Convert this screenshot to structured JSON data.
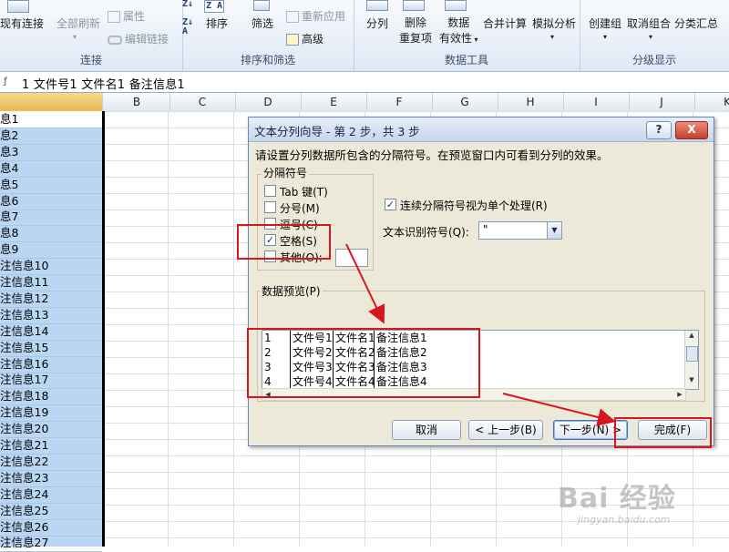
{
  "ribbon": {
    "existing_connections": "现有连接",
    "refresh_all": "全部刷新",
    "properties": "属性",
    "edit_links": "编辑链接",
    "connections_group": "连接",
    "sort_az": "A→Z",
    "sort": "排序",
    "filter": "筛选",
    "reapply": "重新应用",
    "advanced": "高级",
    "sort_filter_group": "排序和筛选",
    "text_to_columns": "分列",
    "remove_duplicates_1": "删除",
    "remove_duplicates_2": "重复项",
    "data_validation_1": "数据",
    "data_validation_2": "有效性",
    "consolidate": "合并计算",
    "what_if": "模拟分析",
    "data_tools_group": "数据工具",
    "group": "创建组",
    "ungroup": "取消组合",
    "subtotal": "分类汇总",
    "outline_group": "分级显示"
  },
  "formula_bar": {
    "content": "1  文件号1  文件名1  备注信息1"
  },
  "columns": [
    "B",
    "C",
    "D",
    "E",
    "F",
    "G",
    "H",
    "I",
    "J",
    "K"
  ],
  "column_a_cells": [
    "息1",
    "息2",
    "息3",
    "息4",
    "息5",
    "息6",
    "息7",
    "息8",
    "息9",
    "注信息10",
    "注信息11",
    "注信息12",
    "注信息13",
    "注信息14",
    "注信息15",
    "注信息16",
    "注信息17",
    "注信息18",
    "注信息19",
    "注信息20",
    "注信息21",
    "注信息22",
    "注信息23",
    "注信息24",
    "注信息25",
    "注信息26",
    "注信息27"
  ],
  "dialog": {
    "title": "文本分列向导 - 第 2 步，共 3 步",
    "help_button": "?",
    "close_button": "X",
    "instruction": "请设置分列数据所包含的分隔符号。在预览窗口内可看到分列的效果。",
    "delimiters_legend": "分隔符号",
    "delimiters": [
      {
        "label": "Tab 键(T)",
        "checked": false
      },
      {
        "label": "分号(M)",
        "checked": false
      },
      {
        "label": "逗号(C)",
        "checked": false
      },
      {
        "label": "空格(S)",
        "checked": true
      },
      {
        "label": "其他(O):",
        "checked": false
      }
    ],
    "consecutive_label": "连续分隔符号视为单个处理(R)",
    "consecutive_checked": true,
    "text_qualifier_label": "文本识别符号(Q):",
    "text_qualifier_value": "\"",
    "preview_label": "数据预览(P)",
    "preview_rows": [
      [
        "1",
        "文件号1",
        "文件名1",
        "备注信息1"
      ],
      [
        "2",
        "文件号2",
        "文件名2",
        "备注信息2"
      ],
      [
        "3",
        "文件号3",
        "文件名3",
        "备注信息3"
      ],
      [
        "4",
        "文件号4",
        "文件名4",
        "备注信息4"
      ]
    ],
    "buttons": {
      "cancel": "取消",
      "back": "< 上一步(B)",
      "next": "下一步(N) >",
      "finish": "完成(F)"
    }
  },
  "watermark": {
    "logo": "Bai 经验",
    "sub": "jingyan.baidu.com"
  },
  "colors": {
    "selection": "#b9d7f3",
    "annotation_red": "#d9161c",
    "dialog_bg": "#ece9d8"
  }
}
